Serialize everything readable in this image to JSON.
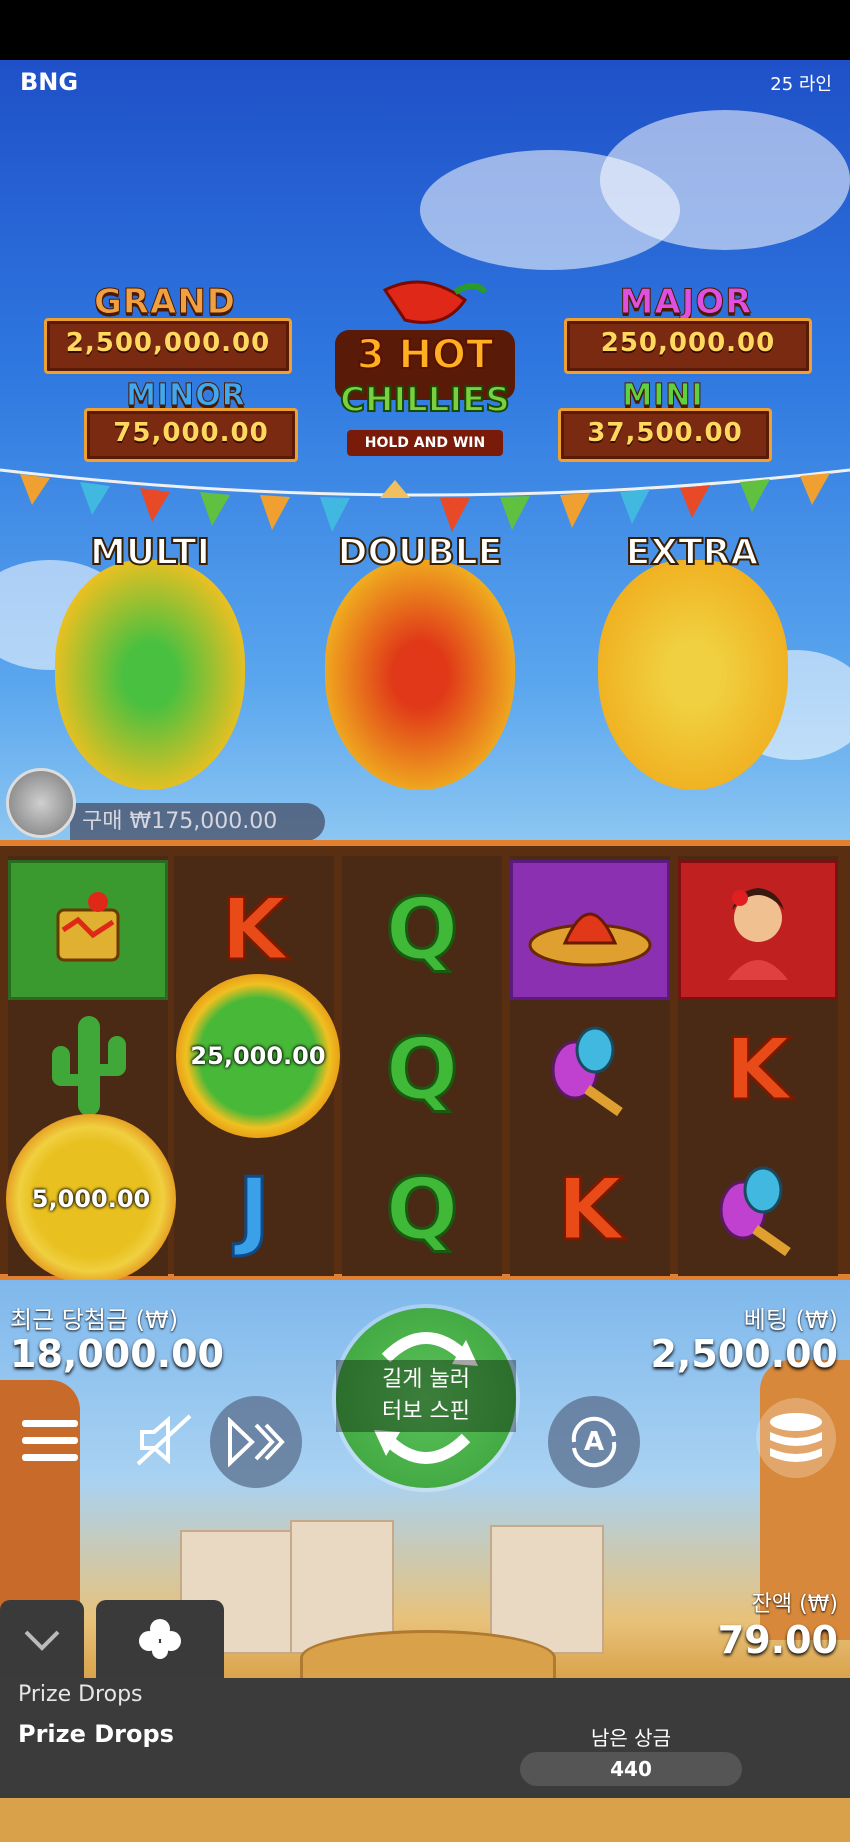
{
  "header": {
    "brand": "BNG",
    "lines": "25 라인"
  },
  "jackpots": {
    "grand": {
      "title": "GRAND",
      "value": "2,500,000.00",
      "color": "#f0a040"
    },
    "minor": {
      "title": "MINOR",
      "value": "75,000.00",
      "color": "#40a0f0"
    },
    "major": {
      "title": "MAJOR",
      "value": "250,000.00",
      "color": "#e040e0"
    },
    "mini": {
      "title": "MINI",
      "value": "37,500.00",
      "color": "#60d040"
    }
  },
  "logo": {
    "line1": "3 HOT",
    "line2": "CHILLIES",
    "tagline": "HOLD AND WIN"
  },
  "features": [
    {
      "label": "MULTI",
      "color": "#38a838"
    },
    {
      "label": "DOUBLE",
      "color": "#e84020"
    },
    {
      "label": "EXTRA",
      "color": "#f0c020"
    }
  ],
  "buy": {
    "label": "구매 ₩175,000.00"
  },
  "reels": {
    "coins": {
      "green_value": "25,000.00",
      "gold_value": "5,000.00"
    },
    "symbols": {
      "r2_top": "K",
      "r2_bot": "J",
      "r3_top": "Q",
      "r3_mid": "Q",
      "r3_bot": "Q",
      "r4_bot": "K",
      "r5_mid": "K"
    }
  },
  "stats": {
    "last_win_label": "최근 당첨금 (₩)",
    "last_win_value": "18,000.00",
    "bet_label": "베팅 (₩)",
    "bet_value": "2,500.00",
    "balance_label": "잔액 (₩)",
    "balance_value": "79.00"
  },
  "controls": {
    "spin_text_line1": "길게 눌러",
    "spin_text_line2": "터보 스핀",
    "auto_label": "A",
    "icons": [
      "menu-icon",
      "mute-icon",
      "fast-forward-icon",
      "autoplay-icon",
      "coins-icon",
      "chevron-down-icon",
      "clover-icon"
    ]
  },
  "prize_drops": {
    "subtitle": "Prize Drops",
    "title": "Prize Drops",
    "remaining_label": "남은 상금",
    "remaining_value": "440"
  }
}
